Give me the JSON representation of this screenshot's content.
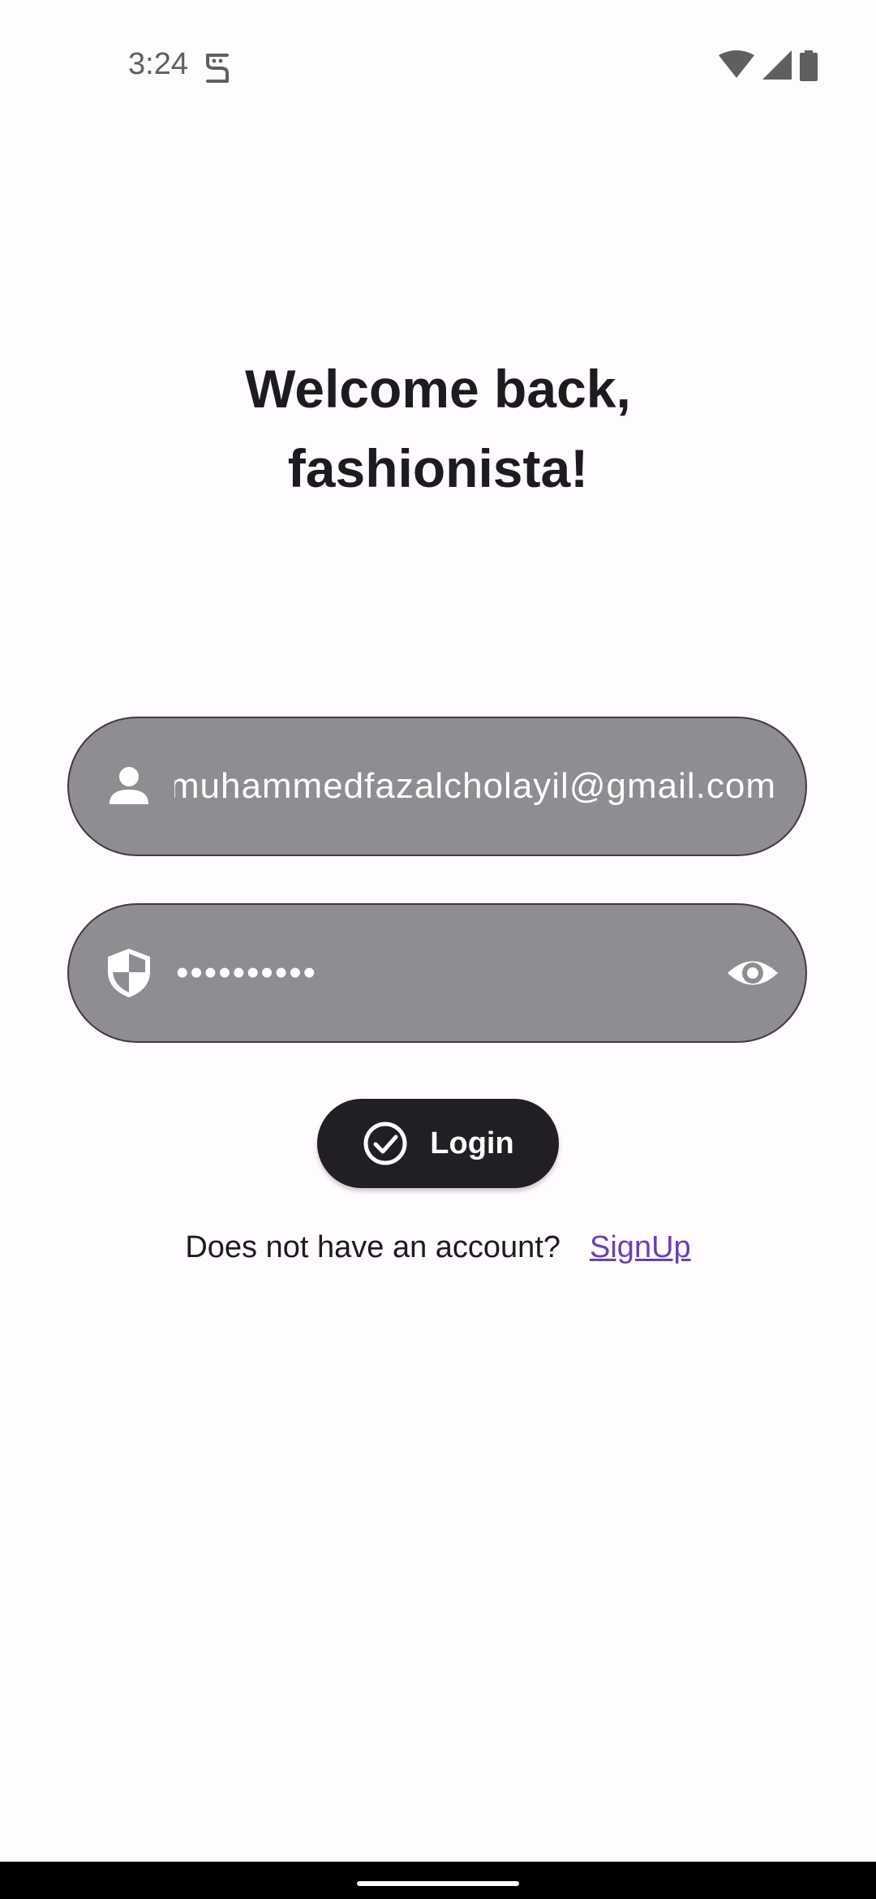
{
  "status_bar": {
    "time": "3:24",
    "icons": [
      "notification-glyph-icon",
      "wifi-icon",
      "cell-signal-icon",
      "battery-icon"
    ]
  },
  "header": {
    "title_line1": "Welcome back,",
    "title_line2": "fashionista!"
  },
  "form": {
    "email": {
      "icon": "person-icon",
      "value": "muhammedfazalcholayil@gmail.com"
    },
    "password": {
      "icon": "shield-icon",
      "value": "••••••••••",
      "toggle_icon": "eye-icon"
    },
    "login_button": {
      "icon": "check-circle-icon",
      "label": "Login"
    }
  },
  "signup": {
    "prompt": "Does not have an account?",
    "link": "SignUp"
  },
  "colors": {
    "background": "#fffbfe",
    "field_fill": "#8f8d91",
    "field_border": "#3e3c42",
    "button_fill": "#211f24",
    "link": "#6a3fb6"
  }
}
